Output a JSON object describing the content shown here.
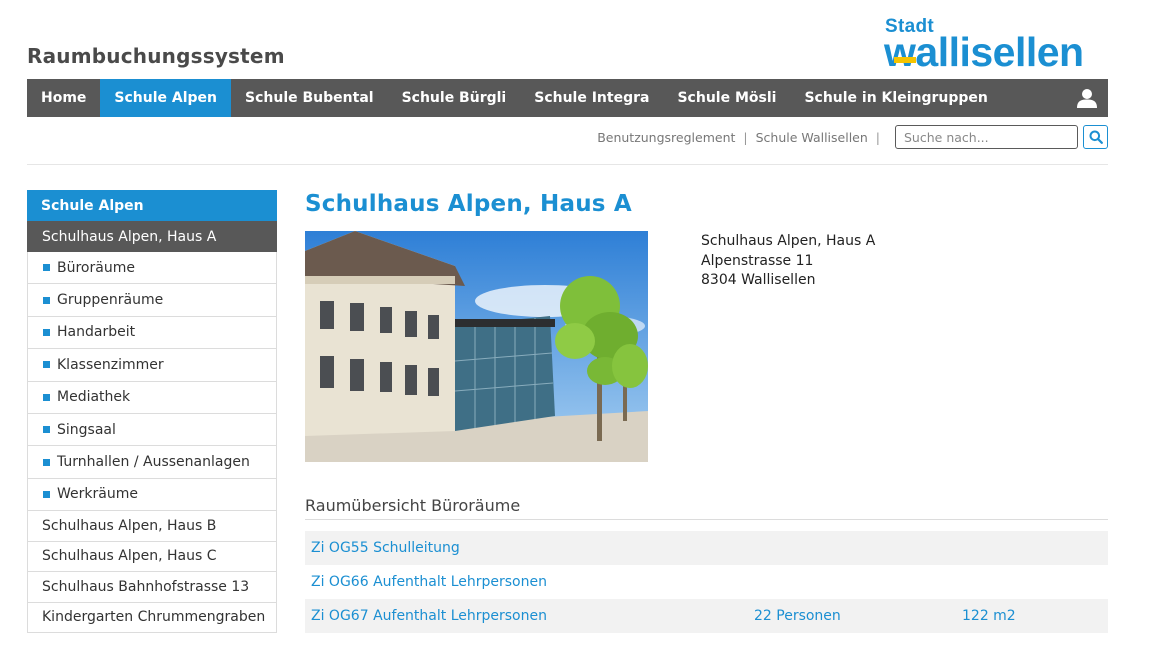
{
  "header": {
    "site_title": "Raumbuchungssystem",
    "logo_small": "Stadt",
    "logo_large": "wallisellen"
  },
  "nav": {
    "items": [
      {
        "label": "Home",
        "active": false
      },
      {
        "label": "Schule Alpen",
        "active": true
      },
      {
        "label": "Schule Bubental",
        "active": false
      },
      {
        "label": "Schule Bürgli",
        "active": false
      },
      {
        "label": "Schule Integra",
        "active": false
      },
      {
        "label": "Schule Mösli",
        "active": false
      },
      {
        "label": "Schule in Kleingruppen",
        "active": false
      }
    ],
    "user_icon": "user-icon"
  },
  "utility": {
    "link1": "Benutzungsreglement",
    "link2": "Schule Wallisellen",
    "separator": "|",
    "search_placeholder": "Suche nach...",
    "search_icon": "search-icon"
  },
  "sidebar": {
    "heading": "Schule Alpen",
    "current": "Schulhaus Alpen, Haus A",
    "subitems": [
      "Büroräume",
      "Gruppenräume",
      "Handarbeit",
      "Klassenzimmer",
      "Mediathek",
      "Singsaal",
      "Turnhallen / Aussenanlagen",
      "Werkräume"
    ],
    "items": [
      "Schulhaus Alpen, Haus B",
      "Schulhaus Alpen, Haus C",
      "Schulhaus Bahnhofstrasse 13",
      "Kindergarten Chrummengraben"
    ]
  },
  "main": {
    "title": "Schulhaus Alpen, Haus A",
    "address": {
      "line1": "Schulhaus Alpen, Haus A",
      "line2": "Alpenstrasse 11",
      "line3": "8304 Wallisellen"
    },
    "section_title": "Raumübersicht Büroräume",
    "rooms": [
      {
        "name": "Zi OG55 Schulleitung",
        "persons": "",
        "area": ""
      },
      {
        "name": "Zi OG66 Aufenthalt Lehrpersonen",
        "persons": "",
        "area": ""
      },
      {
        "name": "Zi OG67 Aufenthalt Lehrpersonen",
        "persons": "22 Personen",
        "area": "122 m2"
      }
    ]
  },
  "colors": {
    "accent": "#1b8fd2",
    "nav_bg": "#585858",
    "logo_stripe": "#f5c400"
  }
}
